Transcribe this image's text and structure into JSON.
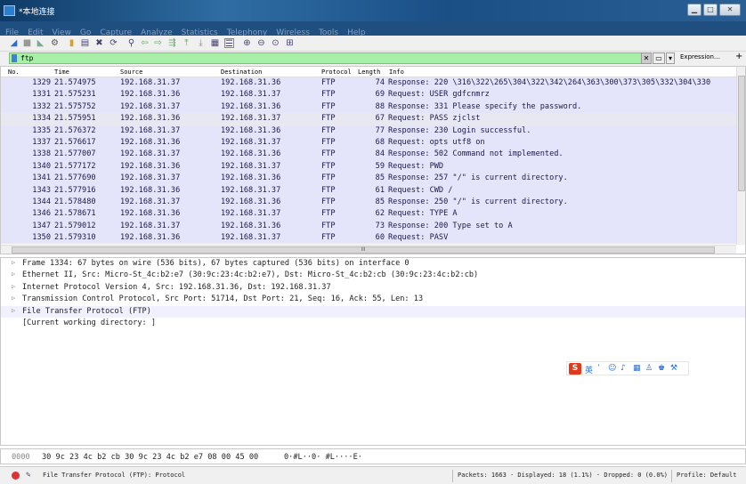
{
  "window": {
    "title": "*本地连接"
  },
  "menu": [
    "File",
    "Edit",
    "View",
    "Go",
    "Capture",
    "Analyze",
    "Statistics",
    "Telephony",
    "Wireless",
    "Tools",
    "Help"
  ],
  "filter": {
    "value": "ftp",
    "expression_label": "Expression…",
    "plus_label": "+"
  },
  "columns": {
    "no": "No.",
    "time": "Time",
    "source": "Source",
    "destination": "Destination",
    "protocol": "Protocol",
    "length": "Length",
    "info": "Info"
  },
  "packets": [
    {
      "no": "1329",
      "time": "21.574975",
      "src": "192.168.31.37",
      "dst": "192.168.31.36",
      "proto": "FTP",
      "len": "74",
      "info": "Response: 220 \\316\\322\\265\\304\\322\\342\\264\\363\\300\\373\\305\\332\\304\\330"
    },
    {
      "no": "1331",
      "time": "21.575231",
      "src": "192.168.31.36",
      "dst": "192.168.31.37",
      "proto": "FTP",
      "len": "69",
      "info": "Request: USER gdfcnmrz"
    },
    {
      "no": "1332",
      "time": "21.575752",
      "src": "192.168.31.37",
      "dst": "192.168.31.36",
      "proto": "FTP",
      "len": "88",
      "info": "Response: 331 Please specify the password."
    },
    {
      "no": "1334",
      "time": "21.575951",
      "src": "192.168.31.36",
      "dst": "192.168.31.37",
      "proto": "FTP",
      "len": "67",
      "info": "Request: PASS zjclst"
    },
    {
      "no": "1335",
      "time": "21.576372",
      "src": "192.168.31.37",
      "dst": "192.168.31.36",
      "proto": "FTP",
      "len": "77",
      "info": "Response: 230 Login successful."
    },
    {
      "no": "1337",
      "time": "21.576617",
      "src": "192.168.31.36",
      "dst": "192.168.31.37",
      "proto": "FTP",
      "len": "68",
      "info": "Request: opts utf8 on"
    },
    {
      "no": "1338",
      "time": "21.577007",
      "src": "192.168.31.37",
      "dst": "192.168.31.36",
      "proto": "FTP",
      "len": "84",
      "info": "Response: 502 Command not implemented."
    },
    {
      "no": "1340",
      "time": "21.577172",
      "src": "192.168.31.36",
      "dst": "192.168.31.37",
      "proto": "FTP",
      "len": "59",
      "info": "Request: PWD"
    },
    {
      "no": "1341",
      "time": "21.577690",
      "src": "192.168.31.37",
      "dst": "192.168.31.36",
      "proto": "FTP",
      "len": "85",
      "info": "Response: 257 \"/\" is current directory."
    },
    {
      "no": "1343",
      "time": "21.577916",
      "src": "192.168.31.36",
      "dst": "192.168.31.37",
      "proto": "FTP",
      "len": "61",
      "info": "Request: CWD /"
    },
    {
      "no": "1344",
      "time": "21.578480",
      "src": "192.168.31.37",
      "dst": "192.168.31.36",
      "proto": "FTP",
      "len": "85",
      "info": "Response: 250 \"/\" is current directory."
    },
    {
      "no": "1346",
      "time": "21.578671",
      "src": "192.168.31.36",
      "dst": "192.168.31.37",
      "proto": "FTP",
      "len": "62",
      "info": "Request: TYPE A"
    },
    {
      "no": "1347",
      "time": "21.579012",
      "src": "192.168.31.37",
      "dst": "192.168.31.36",
      "proto": "FTP",
      "len": "73",
      "info": "Response: 200 Type set to A"
    },
    {
      "no": "1350",
      "time": "21.579310",
      "src": "192.168.31.36",
      "dst": "192.168.31.37",
      "proto": "FTP",
      "len": "60",
      "info": "Request: PASV"
    }
  ],
  "hscroll_label": "III",
  "details": [
    "Frame 1334: 67 bytes on wire (536 bits), 67 bytes captured (536 bits) on interface 0",
    "Ethernet II, Src: Micro-St_4c:b2:e7 (30:9c:23:4c:b2:e7), Dst: Micro-St_4c:b2:cb (30:9c:23:4c:b2:cb)",
    "Internet Protocol Version 4, Src: 192.168.31.36, Dst: 192.168.31.37",
    "Transmission Control Protocol, Src Port: 51714, Dst Port: 21, Seq: 16, Ack: 55, Len: 13",
    "File Transfer Protocol (FTP)",
    "[Current working directory: ]"
  ],
  "ime": {
    "logo": "S",
    "label": "英"
  },
  "bytes": {
    "offset": "0000",
    "hex": "30 9c 23 4c b2 cb 30 9c  23 4c b2 e7 08 00 45 00",
    "ascii": "0·#L··0· #L····E·"
  },
  "status": {
    "protocol": "File Transfer Protocol (FTP): Protocol",
    "packets": "Packets: 1663 · Displayed: 18 (1.1%) · Dropped: 0 (0.0%)",
    "profile": "Profile: Default"
  }
}
